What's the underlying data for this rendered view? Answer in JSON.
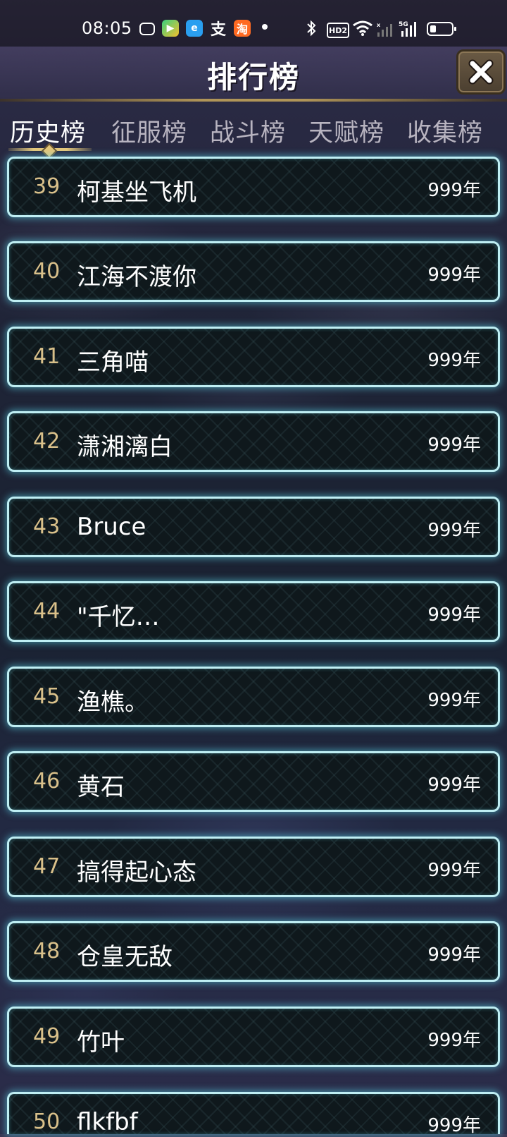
{
  "status_bar": {
    "time": "08:05",
    "hd_label": "HD2",
    "network_label": "5G"
  },
  "header": {
    "title": "排行榜"
  },
  "tabs": [
    {
      "label": "历史榜",
      "active": true
    },
    {
      "label": "征服榜",
      "active": false
    },
    {
      "label": "战斗榜",
      "active": false
    },
    {
      "label": "天赋榜",
      "active": false
    },
    {
      "label": "收集榜",
      "active": false
    }
  ],
  "rankings": [
    {
      "rank": "39",
      "name": "柯基坐飞机",
      "value": "999年"
    },
    {
      "rank": "40",
      "name": "江海不渡你",
      "value": "999年"
    },
    {
      "rank": "41",
      "name": "三角喵",
      "value": "999年"
    },
    {
      "rank": "42",
      "name": "潇湘漓白",
      "value": "999年"
    },
    {
      "rank": "43",
      "name": "Bruce",
      "value": "999年"
    },
    {
      "rank": "44",
      "name": "\"千忆…",
      "value": "999年"
    },
    {
      "rank": "45",
      "name": "渔樵。",
      "value": "999年"
    },
    {
      "rank": "46",
      "name": "黄石",
      "value": "999年"
    },
    {
      "rank": "47",
      "name": "搞得起心态",
      "value": "999年"
    },
    {
      "rank": "48",
      "name": "仓皇无敌",
      "value": "999年"
    },
    {
      "rank": "49",
      "name": "竹叶",
      "value": "999年"
    },
    {
      "rank": "50",
      "name": "flkfbf",
      "value": "999年"
    }
  ],
  "colors": {
    "row_border": "#bfeef3",
    "row_glow": "#5ad2e6",
    "rank_number": "#d9c08a",
    "tab_active": "#ffffff",
    "tab_inactive": "#b8b4c0",
    "tab_accent": "#e6c77a"
  },
  "icons": {
    "close": "close-x-icon",
    "bluetooth": "bluetooth-icon",
    "wifi": "wifi-icon",
    "battery": "battery-icon"
  }
}
